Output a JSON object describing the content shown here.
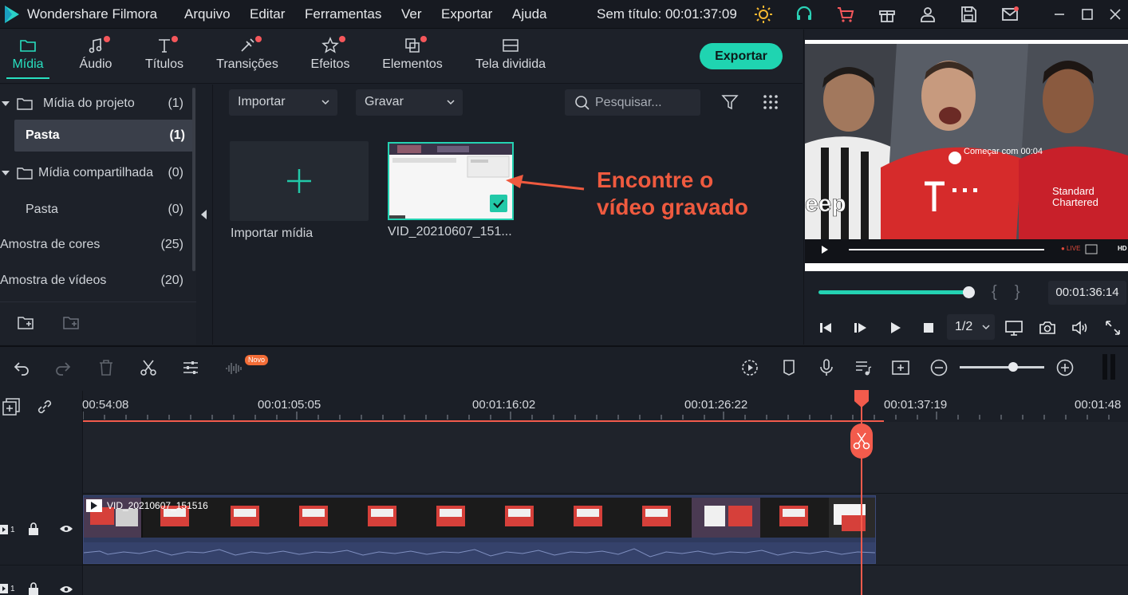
{
  "app": {
    "name": "Wondershare Filmora",
    "project_title": "Sem título: 00:01:37:09"
  },
  "menu": [
    "Arquivo",
    "Editar",
    "Ferramentas",
    "Ver",
    "Exportar",
    "Ajuda"
  ],
  "tabs": [
    {
      "label": "Mídia",
      "icon": "folder-icon",
      "active": true,
      "badge": false
    },
    {
      "label": "Áudio",
      "icon": "music-note-icon",
      "active": false,
      "badge": true
    },
    {
      "label": "Títulos",
      "icon": "text-title-icon",
      "active": false,
      "badge": true
    },
    {
      "label": "Transições",
      "icon": "transition-icon",
      "active": false,
      "badge": true
    },
    {
      "label": "Efeitos",
      "icon": "effects-star-icon",
      "active": false,
      "badge": true
    },
    {
      "label": "Elementos",
      "icon": "elements-icon",
      "active": false,
      "badge": true
    },
    {
      "label": "Tela dividida",
      "icon": "split-screen-icon",
      "active": false,
      "badge": false
    }
  ],
  "export_label": "Exportar",
  "library": {
    "items": [
      {
        "name": "Mídia do projeto",
        "count": "(1)"
      },
      {
        "name": "Pasta",
        "count": "(1)"
      },
      {
        "name": "Mídia compartilhada",
        "count": "(0)"
      },
      {
        "name": "Pasta",
        "count": "(0)"
      },
      {
        "name": "Amostra de cores",
        "count": "(25)"
      },
      {
        "name": "Amostra de vídeos",
        "count": "(20)"
      }
    ]
  },
  "media": {
    "import_dropdown": "Importar",
    "record_dropdown": "Gravar",
    "search_placeholder": "Pesquisar...",
    "import_tile_label": "Importar mídia",
    "clip_label": "VID_20210607_151...",
    "annotation_line1": "Encontre o",
    "annotation_line2": "vídeo gravado"
  },
  "preview": {
    "caption": "Começar com 00:04",
    "timecode": "00:01:36:14",
    "zoom": "1/2",
    "progress": 0.88
  },
  "timeline": {
    "novo_badge": "Novo",
    "ruler_labels": [
      "00:54:08",
      "00:01:05:05",
      "00:01:16:02",
      "00:01:26:22",
      "00:01:37:19",
      "00:01:48"
    ],
    "clip_name": "VID_20210607_151516",
    "track1_label": "1",
    "track2_label": "1"
  }
}
